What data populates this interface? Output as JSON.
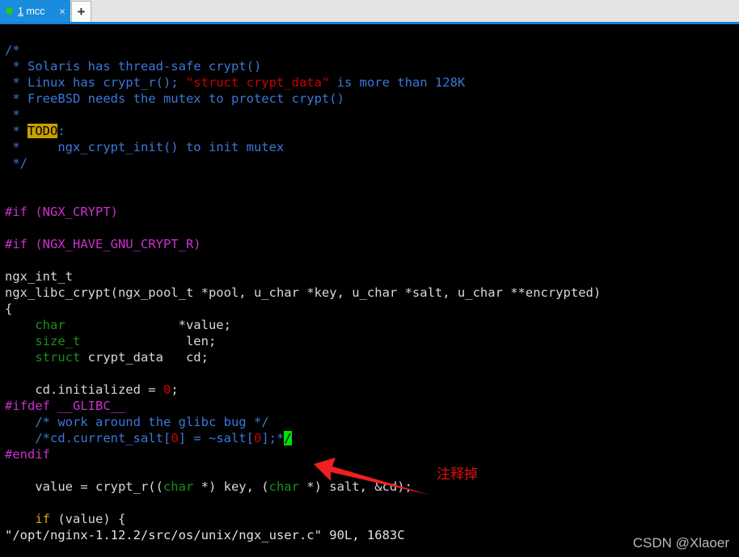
{
  "window": {
    "tabbar": {
      "active_tab": {
        "number": "1",
        "title": "mcc",
        "status_dot_color": "#21c521",
        "close_label": "×"
      },
      "new_tab_label": "+",
      "accent_color": "#1a8cdd",
      "background_color": "#e4e4e4"
    }
  },
  "terminal": {
    "background_color": "#000000",
    "foreground_color": "#d8d8d8",
    "editor": "vim",
    "cursor": {
      "char": "/",
      "background_color": "#00e000",
      "foreground_color": "#000000"
    },
    "colors": {
      "comment": "#3a78d8",
      "string": "#cc0000",
      "preprocessor": "#cc30cc",
      "type": "#1a8f1a",
      "number": "#cc0000",
      "conditional": "#d8a800",
      "todo_highlight_bg": "#c8a000"
    },
    "lines": [
      {
        "id": 1,
        "segments": [
          {
            "text": "/*",
            "cls": "c-comment"
          }
        ]
      },
      {
        "id": 2,
        "segments": [
          {
            "text": " * Solaris has thread-safe crypt()",
            "cls": "c-comment"
          }
        ]
      },
      {
        "id": 3,
        "segments": [
          {
            "text": " * Linux has crypt_r(); ",
            "cls": "c-comment"
          },
          {
            "text": "\"struct crypt_data\"",
            "cls": "c-string"
          },
          {
            "text": " is more than 128K",
            "cls": "c-comment"
          }
        ]
      },
      {
        "id": 4,
        "segments": [
          {
            "text": " * FreeBSD needs the mutex to protect crypt()",
            "cls": "c-comment"
          }
        ]
      },
      {
        "id": 5,
        "segments": [
          {
            "text": " *",
            "cls": "c-comment"
          }
        ]
      },
      {
        "id": 6,
        "segments": [
          {
            "text": " * ",
            "cls": "c-comment"
          },
          {
            "text": "TODO",
            "cls": "c-todo"
          },
          {
            "text": ":",
            "cls": "c-comment"
          }
        ]
      },
      {
        "id": 7,
        "segments": [
          {
            "text": " *     ngx_crypt_init() to init mutex",
            "cls": "c-comment"
          }
        ]
      },
      {
        "id": 8,
        "segments": [
          {
            "text": " */",
            "cls": "c-comment"
          }
        ]
      },
      {
        "id": 9,
        "segments": [
          {
            "text": "",
            "cls": ""
          }
        ]
      },
      {
        "id": 10,
        "segments": [
          {
            "text": "",
            "cls": ""
          }
        ]
      },
      {
        "id": 11,
        "segments": [
          {
            "text": "#if (NGX_CRYPT)",
            "cls": "c-pre"
          }
        ]
      },
      {
        "id": 12,
        "segments": [
          {
            "text": "",
            "cls": ""
          }
        ]
      },
      {
        "id": 13,
        "segments": [
          {
            "text": "#if (NGX_HAVE_GNU_CRYPT_R)",
            "cls": "c-pre"
          }
        ]
      },
      {
        "id": 14,
        "segments": [
          {
            "text": "",
            "cls": ""
          }
        ]
      },
      {
        "id": 15,
        "segments": [
          {
            "text": "ngx_int_t",
            "cls": "c-ident"
          }
        ]
      },
      {
        "id": 16,
        "segments": [
          {
            "text": "ngx_libc_crypt(ngx_pool_t *pool, u_char *key, u_char *salt, u_char **encrypted)",
            "cls": "c-ident"
          }
        ]
      },
      {
        "id": 17,
        "segments": [
          {
            "text": "{",
            "cls": "c-ident"
          }
        ]
      },
      {
        "id": 18,
        "segments": [
          {
            "text": "    ",
            "cls": "c-ident"
          },
          {
            "text": "char",
            "cls": "c-type"
          },
          {
            "text": "               *value;",
            "cls": "c-ident"
          }
        ]
      },
      {
        "id": 19,
        "segments": [
          {
            "text": "    ",
            "cls": "c-ident"
          },
          {
            "text": "size_t",
            "cls": "c-type"
          },
          {
            "text": "              len;",
            "cls": "c-ident"
          }
        ]
      },
      {
        "id": 20,
        "segments": [
          {
            "text": "    ",
            "cls": "c-ident"
          },
          {
            "text": "struct",
            "cls": "c-type"
          },
          {
            "text": " crypt_data   cd;",
            "cls": "c-ident"
          }
        ]
      },
      {
        "id": 21,
        "segments": [
          {
            "text": "",
            "cls": ""
          }
        ]
      },
      {
        "id": 22,
        "segments": [
          {
            "text": "    cd.initialized = ",
            "cls": "c-ident"
          },
          {
            "text": "0",
            "cls": "c-number"
          },
          {
            "text": ";",
            "cls": "c-ident"
          }
        ]
      },
      {
        "id": 23,
        "segments": [
          {
            "text": "#ifdef __GLIBC__",
            "cls": "c-pre"
          }
        ]
      },
      {
        "id": 24,
        "segments": [
          {
            "text": "    ",
            "cls": "c-ident"
          },
          {
            "text": "/* work around the glibc bug */",
            "cls": "c-comment"
          }
        ]
      },
      {
        "id": 25,
        "segments": [
          {
            "text": "    ",
            "cls": "c-ident"
          },
          {
            "text": "/*cd.current_salt[",
            "cls": "c-comment"
          },
          {
            "text": "0",
            "cls": "c-number"
          },
          {
            "text": "] = ~salt[",
            "cls": "c-comment"
          },
          {
            "text": "0",
            "cls": "c-number"
          },
          {
            "text": "];*",
            "cls": "c-comment"
          },
          {
            "text": "/",
            "cls": "cursor"
          }
        ]
      },
      {
        "id": 26,
        "segments": [
          {
            "text": "#endif",
            "cls": "c-pre"
          }
        ]
      },
      {
        "id": 27,
        "segments": [
          {
            "text": "",
            "cls": ""
          }
        ]
      },
      {
        "id": 28,
        "segments": [
          {
            "text": "    value = crypt_r((",
            "cls": "c-ident"
          },
          {
            "text": "char",
            "cls": "c-type"
          },
          {
            "text": " *) key, (",
            "cls": "c-ident"
          },
          {
            "text": "char",
            "cls": "c-type"
          },
          {
            "text": " *) salt, &cd);",
            "cls": "c-ident"
          }
        ]
      },
      {
        "id": 29,
        "segments": [
          {
            "text": "",
            "cls": ""
          }
        ]
      },
      {
        "id": 30,
        "segments": [
          {
            "text": "    ",
            "cls": "c-ident"
          },
          {
            "text": "if",
            "cls": "c-cond"
          },
          {
            "text": " (value) {",
            "cls": "c-ident"
          }
        ]
      }
    ],
    "status_line": "\"/opt/nginx-1.12.2/src/os/unix/ngx_user.c\" 90L, 1683C"
  },
  "annotation": {
    "text": "注释掉",
    "color": "#e01010",
    "arrow_color": "#f02020"
  },
  "watermark": {
    "text": "CSDN @Xlaoer"
  }
}
